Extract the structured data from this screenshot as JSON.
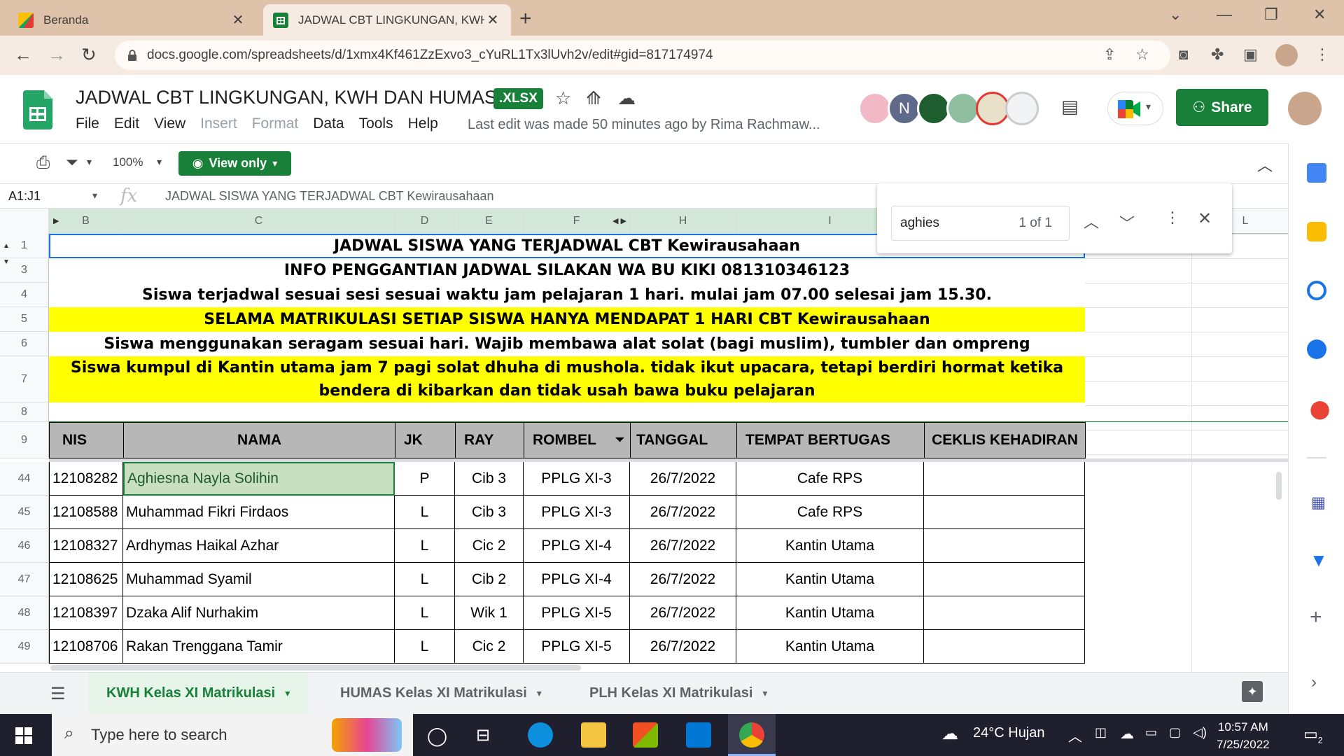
{
  "browser": {
    "tabs": [
      {
        "title": "Beranda",
        "active": false
      },
      {
        "title": "JADWAL CBT LINGKUNGAN, KWH",
        "active": true
      }
    ],
    "url": "docs.google.com/spreadsheets/d/1xmx4Kf461ZzExvo3_cYuRL1Tx3lUvh2v/edit#gid=817174974"
  },
  "doc": {
    "title": "JADWAL CBT LINGKUNGAN, KWH DAN HUMAS",
    "badge": ".XLSX",
    "menu": [
      "File",
      "Edit",
      "View",
      "Insert",
      "Format",
      "Data",
      "Tools",
      "Help"
    ],
    "last_edit": "Last edit was made 50 minutes ago by Rima Rachmaw...",
    "share": "Share",
    "avatar_letter": "N"
  },
  "toolbar": {
    "zoom": "100%",
    "view_only": "View only"
  },
  "formula_bar": {
    "namebox": "A1:J1",
    "fx": "fx",
    "content": "JADWAL SISWA YANG TERJADWAL CBT Kewirausahaan"
  },
  "find": {
    "query": "aghies",
    "count": "1 of 1"
  },
  "columns": [
    "B",
    "C",
    "D",
    "E",
    "F",
    "H",
    "I",
    "L"
  ],
  "banner_rows": [
    {
      "row": "1",
      "text": "JADWAL SISWA YANG TERJADWAL CBT Kewirausahaan",
      "yellow": false
    },
    {
      "row": "3",
      "text": "INFO PENGGANTIAN JADWAL SILAKAN WA BU KIKI 081310346123",
      "yellow": false
    },
    {
      "row": "4",
      "text": "Siswa terjadwal sesuai sesi sesuai waktu jam pelajaran 1 hari. mulai jam 07.00 selesai jam 15.30.",
      "yellow": false
    },
    {
      "row": "5",
      "text": "SELAMA MATRIKULASI SETIAP SISWA HANYA MENDAPAT 1 HARI CBT Kewirausahaan",
      "yellow": true
    },
    {
      "row": "6",
      "text": "Siswa menggunakan seragam sesuai hari. Wajib membawa alat solat (bagi muslim), tumbler dan ompreng",
      "yellow": false
    },
    {
      "row": "7",
      "text": "Siswa kumpul di Kantin utama jam 7 pagi solat dhuha di mushola. tidak ikut upacara, tetapi berdiri hormat ketika bendera di kibarkan dan tidak usah bawa buku pelajaran",
      "yellow": true
    }
  ],
  "row8": "8",
  "table_header": {
    "row": "9",
    "cols": [
      "NIS",
      "NAMA",
      "JK",
      "RAY",
      "ROMBEL",
      "TANGGAL",
      "TEMPAT BERTUGAS",
      "CEKLIS KEHADIRAN"
    ]
  },
  "table_rows": [
    {
      "row": "44",
      "cells": [
        "12108282",
        "Aghiesna Nayla Solihin",
        "P",
        "Cib 3",
        "PPLG XI-3",
        "26/7/2022",
        "Cafe RPS",
        ""
      ]
    },
    {
      "row": "45",
      "cells": [
        "12108588",
        "Muhammad Fikri Firdaos",
        "L",
        "Cib 3",
        "PPLG XI-3",
        "26/7/2022",
        "Cafe RPS",
        ""
      ]
    },
    {
      "row": "46",
      "cells": [
        "12108327",
        "Ardhymas Haikal Azhar",
        "L",
        "Cic 2",
        "PPLG XI-4",
        "26/7/2022",
        "Kantin Utama",
        ""
      ]
    },
    {
      "row": "47",
      "cells": [
        "12108625",
        "Muhammad Syamil",
        "L",
        "Cib 2",
        "PPLG XI-4",
        "26/7/2022",
        "Kantin Utama",
        ""
      ]
    },
    {
      "row": "48",
      "cells": [
        "12108397",
        "Dzaka Alif Nurhakim",
        "L",
        "Wik 1",
        "PPLG XI-5",
        "26/7/2022",
        "Kantin Utama",
        ""
      ]
    },
    {
      "row": "49",
      "cells": [
        "12108706",
        "Rakan Trenggana Tamir",
        "L",
        "Cic 2",
        "PPLG XI-5",
        "26/7/2022",
        "Kantin Utama",
        ""
      ]
    }
  ],
  "sheet_tabs": [
    {
      "label": "KWH Kelas XI Matrikulasi",
      "active": true
    },
    {
      "label": "HUMAS Kelas XI Matrikulasi",
      "active": false
    },
    {
      "label": "PLH Kelas XI Matrikulasi",
      "active": false
    }
  ],
  "taskbar": {
    "search_placeholder": "Type here to search",
    "weather": "24°C  Hujan",
    "time": "10:57 AM",
    "date": "7/25/2022",
    "notif_count": "2"
  },
  "colors": {
    "sheets_green": "#188038",
    "highlight_yellow": "#ffff00",
    "header_gray": "#b7b7b7",
    "selected_cell": "#c9e0c0"
  }
}
